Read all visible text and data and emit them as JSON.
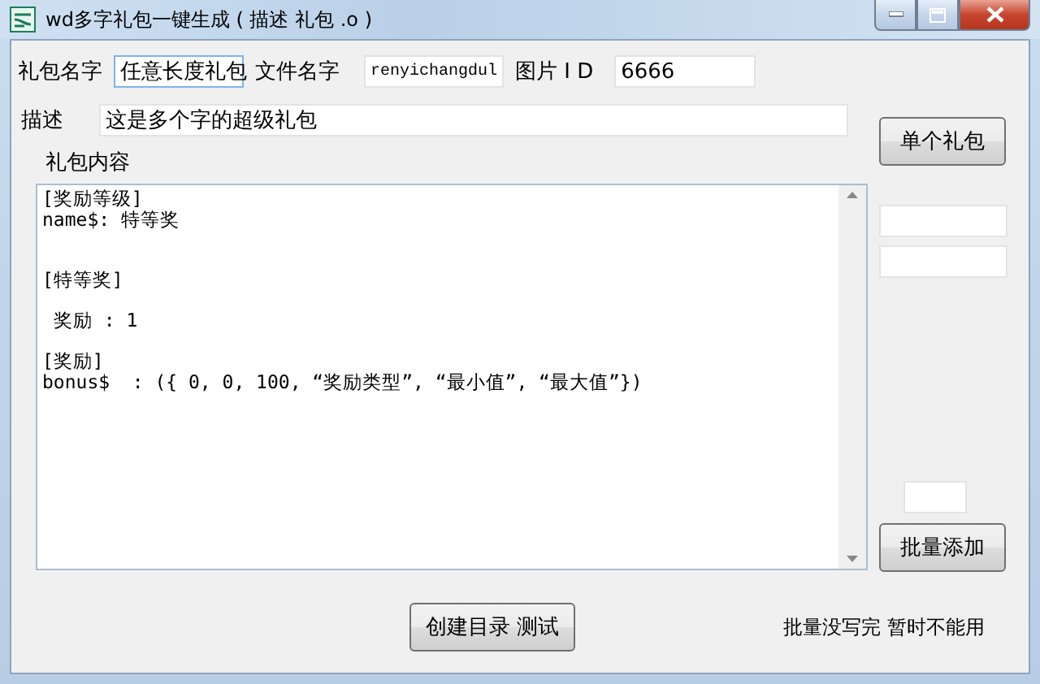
{
  "window": {
    "title": "wd多字礼包一键生成 ( 描述 礼包 .o )"
  },
  "fields": [
    {
      "label": "礼包名字",
      "value": "任意长度礼包",
      "kind": "focused"
    },
    {
      "label": "文件名字",
      "value": "renyichangdul",
      "kind": "mono"
    },
    {
      "label": "图片 I D",
      "value": "6666",
      "kind": "plain"
    }
  ],
  "description": {
    "label": "描述",
    "value": "这是多个字的超级礼包"
  },
  "content": {
    "label": "礼包内容",
    "text": "[奖励等级]\nname$: 特等奖\n\n\n[特等奖]\n\n 奖励 : 1\n\n[奖励]\nbonus$  : ({ 0, 0, 100, “奖励类型”, “最小值”, “最大值”})"
  },
  "buttons": {
    "single": "单个礼包",
    "batch": "批量添加",
    "create": "创建目录 测试"
  },
  "note": "批量没写完 暂时不能用"
}
